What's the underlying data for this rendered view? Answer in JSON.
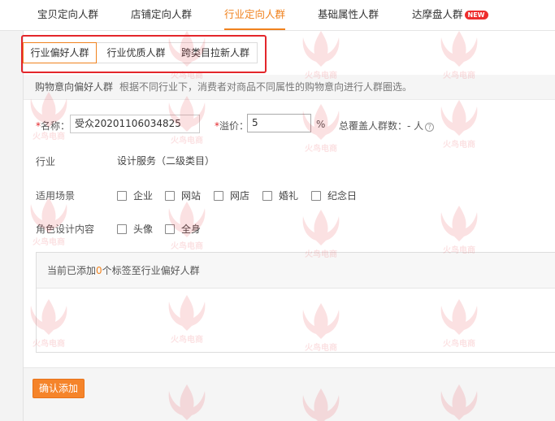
{
  "top_tabs": [
    {
      "label": "宝贝定向人群",
      "active": false
    },
    {
      "label": "店铺定向人群",
      "active": false
    },
    {
      "label": "行业定向人群",
      "active": true
    },
    {
      "label": "基础属性人群",
      "active": false
    },
    {
      "label": "达摩盘人群",
      "active": false,
      "badge": "NEW"
    }
  ],
  "sub_tabs": [
    {
      "label": "行业偏好人群",
      "active": true
    },
    {
      "label": "行业优质人群",
      "active": false
    },
    {
      "label": "跨类目拉新人群",
      "active": false
    }
  ],
  "info": {
    "title": "购物意向偏好人群",
    "description": "根据不同行业下，消费者对商品不同属性的购物意向进行人群圈选。"
  },
  "form": {
    "required_mark": "*",
    "name_label": "名称：",
    "name_value": "受众20201106034825",
    "premium_label": "溢价：",
    "premium_value": "5",
    "premium_unit": "%",
    "coverage_label": "总覆盖人群数：",
    "coverage_value": "- 人",
    "help_icon": "?",
    "industry_label": "行业",
    "industry_value": "设计服务（二级类目）",
    "scenario_label": "适用场景",
    "scenario_options": [
      "企业",
      "网站",
      "网店",
      "婚礼",
      "纪念日"
    ],
    "role_label": "角色设计内容",
    "role_options": [
      "头像",
      "全身"
    ]
  },
  "tag_box": {
    "prefix": "当前已添加",
    "count": "0",
    "suffix": "个标签至行业偏好人群"
  },
  "confirm_button": "确认添加",
  "watermark_text": "火鸟电商",
  "colors": {
    "accent": "#f0821e",
    "highlight_border": "#e3262b",
    "badge": "#ee2d2d",
    "watermark": "#e8323c"
  }
}
